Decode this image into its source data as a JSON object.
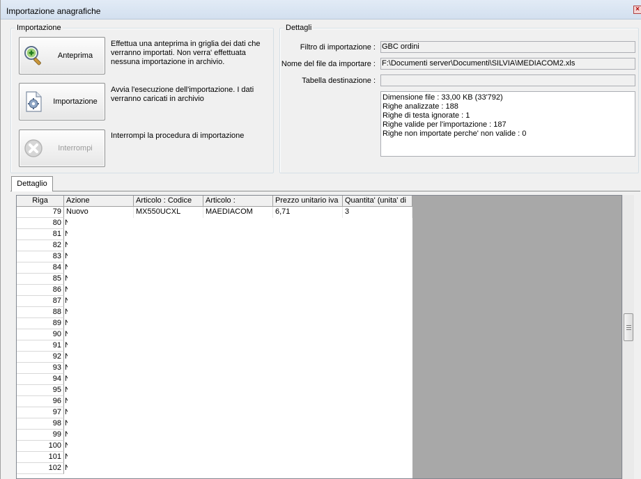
{
  "window": {
    "title": "Importazione anagrafiche"
  },
  "import_group": {
    "legend": "Importazione",
    "buttons": [
      {
        "label": "Anteprima",
        "description": "Effettua una anteprima in griglia dei dati che verranno importati. Non verra' effettuata nessuna importazione in archivio.",
        "enabled": true
      },
      {
        "label": "Importazione",
        "description": "Avvia l'esecuzione dell'importazione. I dati verranno caricati in archivio",
        "enabled": true
      },
      {
        "label": "Interrompi",
        "description": "Interrompi la procedura di importazione",
        "enabled": false
      }
    ]
  },
  "details_group": {
    "legend": "Dettagli",
    "filter_label": "Filtro di importazione :",
    "filter_value": "GBC ordini",
    "filename_label": "Nome del file da importare :",
    "filename_value": "F:\\Documenti server\\Documenti\\SILVIA\\MEDIACOM2.xls",
    "table_label": "Tabella destinazione :",
    "table_value": "",
    "log_lines": [
      "Dimensione file : 33,00 KB (33'792)",
      "Righe analizzate : 188",
      "Righe di testa ignorate : 1",
      "Righe valide per l'importazione : 187",
      "Righe non importate perche' non valide : 0"
    ]
  },
  "tab": {
    "label": "Dettaglio"
  },
  "grid": {
    "columns": [
      "Riga",
      "Azione",
      "Articolo : Codice",
      "Articolo :",
      "Prezzo unitario iva",
      "Quantita' (unita' di"
    ],
    "rows": [
      {
        "riga": "79",
        "azione": "Nuovo",
        "codice": "MX550UCXL",
        "articolo": "MAEDIACOM",
        "prezzo": "6,71",
        "quantita": "3"
      },
      {
        "riga": "80",
        "azione": "N"
      },
      {
        "riga": "81",
        "azione": "N"
      },
      {
        "riga": "82",
        "azione": "N"
      },
      {
        "riga": "83",
        "azione": "N"
      },
      {
        "riga": "84",
        "azione": "N"
      },
      {
        "riga": "85",
        "azione": "N"
      },
      {
        "riga": "86",
        "azione": "N"
      },
      {
        "riga": "87",
        "azione": "N"
      },
      {
        "riga": "88",
        "azione": "N"
      },
      {
        "riga": "89",
        "azione": "N"
      },
      {
        "riga": "90",
        "azione": "N"
      },
      {
        "riga": "91",
        "azione": "N"
      },
      {
        "riga": "92",
        "azione": "N"
      },
      {
        "riga": "93",
        "azione": "N"
      },
      {
        "riga": "94",
        "azione": "N"
      },
      {
        "riga": "95",
        "azione": "N"
      },
      {
        "riga": "96",
        "azione": "N"
      },
      {
        "riga": "97",
        "azione": "N"
      },
      {
        "riga": "98",
        "azione": "N"
      },
      {
        "riga": "99",
        "azione": "N"
      },
      {
        "riga": "100",
        "azione": "N"
      },
      {
        "riga": "101",
        "azione": "N"
      },
      {
        "riga": "102",
        "azione": "N"
      }
    ]
  },
  "icons": {
    "preview": "magnifier-plus-icon",
    "import": "document-gear-icon",
    "stop": "stop-cross-icon",
    "close": "close-icon"
  }
}
